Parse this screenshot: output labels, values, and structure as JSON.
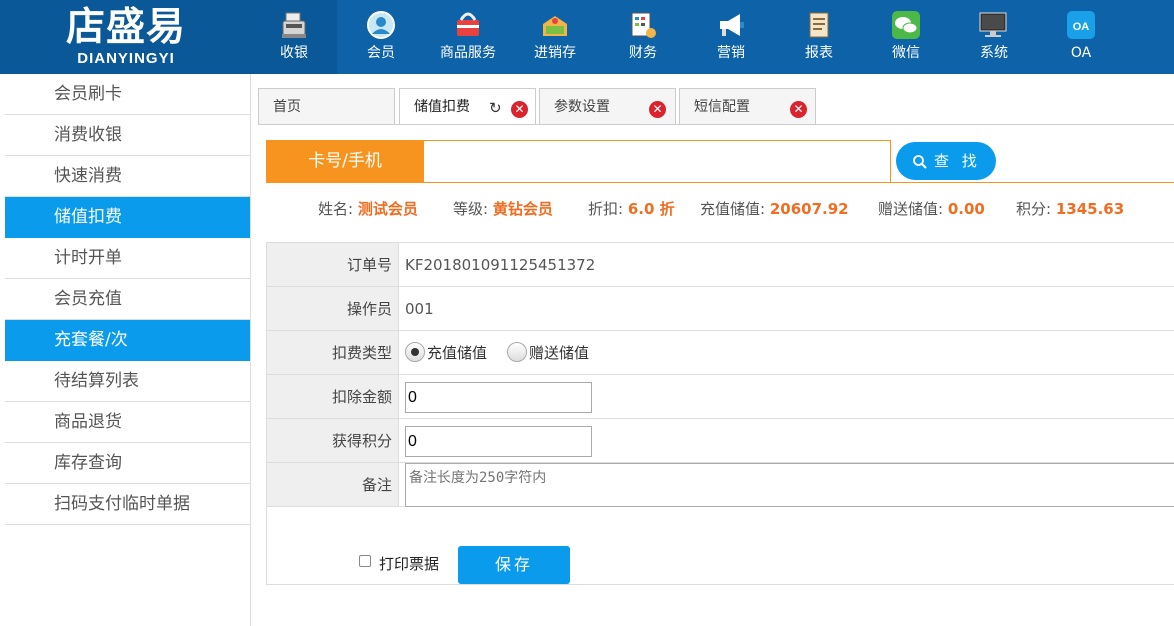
{
  "app": {
    "logo_cn": "店盛易",
    "logo_en": "DIANYINGYI"
  },
  "nav": [
    {
      "label": "收银",
      "icon": "cash-register-icon",
      "active": true
    },
    {
      "label": "会员",
      "icon": "member-icon"
    },
    {
      "label": "商品服务",
      "icon": "product-service-icon"
    },
    {
      "label": "进销存",
      "icon": "inventory-icon"
    },
    {
      "label": "财务",
      "icon": "finance-icon"
    },
    {
      "label": "营销",
      "icon": "megaphone-icon"
    },
    {
      "label": "报表",
      "icon": "report-icon"
    },
    {
      "label": "微信",
      "icon": "wechat-icon"
    },
    {
      "label": "系统",
      "icon": "monitor-icon"
    },
    {
      "label": "OA",
      "icon": "oa-icon",
      "badge": "OA"
    }
  ],
  "sidebar": {
    "items": [
      {
        "label": "会员刷卡"
      },
      {
        "label": "消费收银"
      },
      {
        "label": "快速消费"
      },
      {
        "label": "储值扣费",
        "active": true
      },
      {
        "label": "计时开单"
      },
      {
        "label": "会员充值"
      },
      {
        "label": "充套餐/次",
        "active": true
      },
      {
        "label": "待结算列表"
      },
      {
        "label": "商品退货"
      },
      {
        "label": "库存查询"
      },
      {
        "label": "扫码支付临时单据"
      }
    ]
  },
  "tabs": [
    {
      "label": "首页"
    },
    {
      "label": "储值扣费",
      "active": true
    },
    {
      "label": "参数设置"
    },
    {
      "label": "短信配置"
    }
  ],
  "search": {
    "label": "卡号/手机",
    "value": "",
    "placeholder": "",
    "button": "查 找"
  },
  "member": {
    "name_label": "姓名:",
    "name": "测试会员",
    "level_label": "等级:",
    "level": "黄钻会员",
    "discount_label": "折扣:",
    "discount": "6.0 折",
    "stored_label": "充值储值:",
    "stored": "20607.92",
    "gift_label": "赠送储值:",
    "gift": "0.00",
    "points_label": "积分:",
    "points": "1345.63"
  },
  "form": {
    "order_label": "订单号",
    "order_no": "KF201801091125451372",
    "operator_label": "操作员",
    "operator": "001",
    "type_label": "扣费类型",
    "type_opt1": "充值储值",
    "type_opt2": "赠送储值",
    "type_selected": "充值储值",
    "amount_label": "扣除金额",
    "amount": "0",
    "points_label": "获得积分",
    "points": "0",
    "remark_label": "备注",
    "remark_placeholder": "备注长度为250字符内"
  },
  "footer": {
    "print_label": "打印票据",
    "print_checked": false,
    "save": "保存"
  },
  "colors": {
    "header": "#0d62a8",
    "accent": "#0a9bec",
    "orange": "#f6941f",
    "highlight": "#f06d22",
    "close": "#d9232f"
  }
}
